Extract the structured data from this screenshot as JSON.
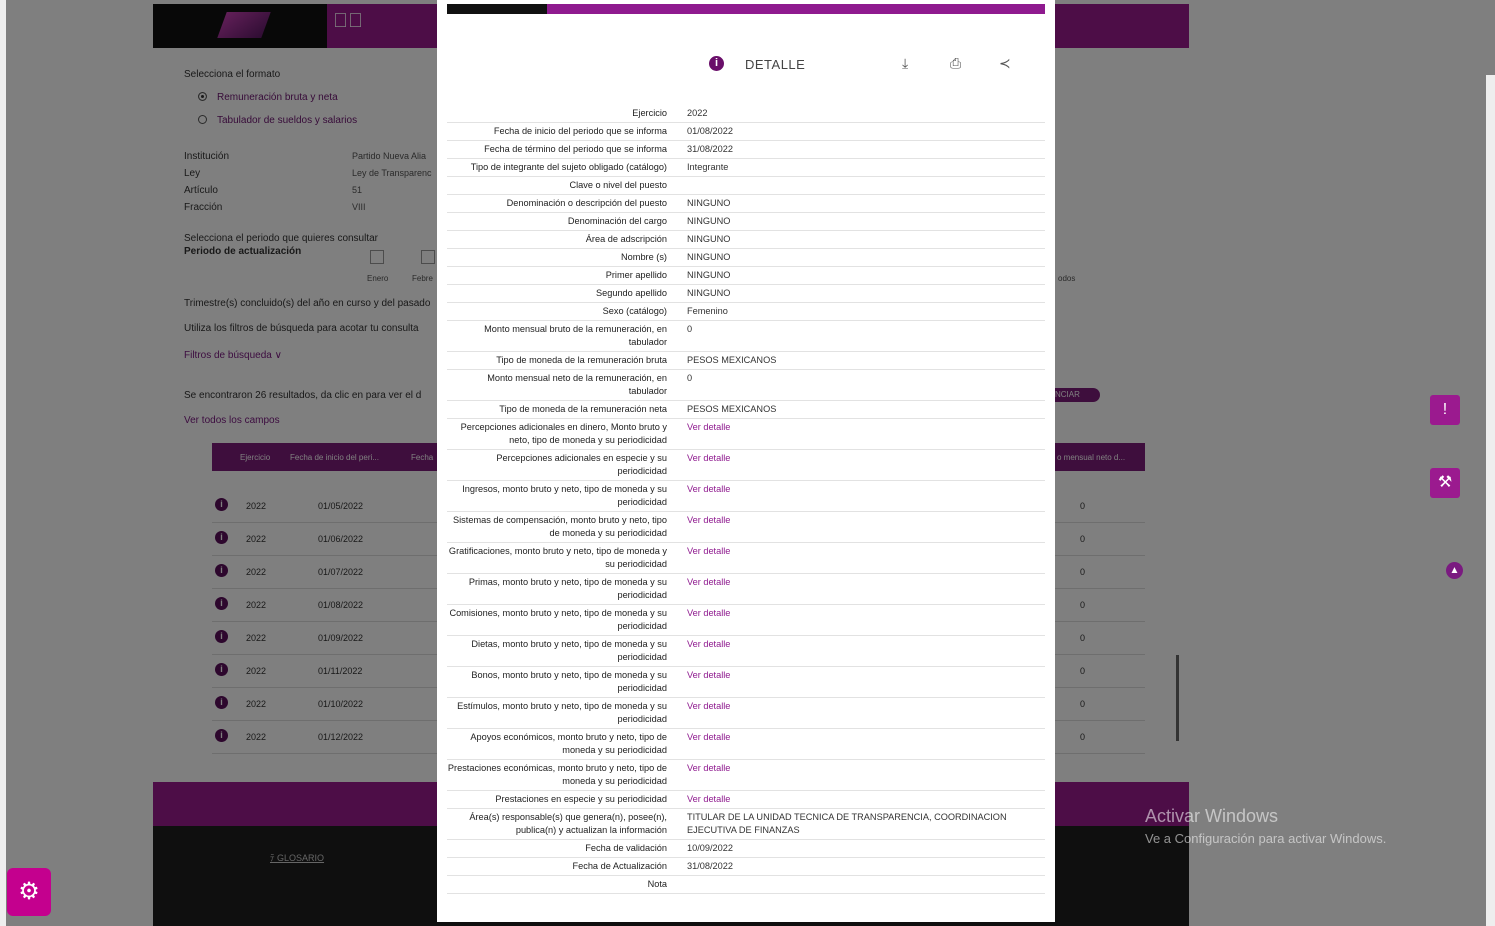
{
  "colors": {
    "brand": "#9b1a8f",
    "dark": "#1e1e1e",
    "link": "#8f1a8f"
  },
  "background": {
    "format_label": "Selecciona el formato",
    "radio_options": [
      "Remuneración bruta y neta",
      "Tabulador de sueldos y salarios"
    ],
    "info": [
      {
        "k": "Institución",
        "v": "Partido Nueva Alia"
      },
      {
        "k": "Ley",
        "v": "Ley de Transparenc"
      },
      {
        "k": "Artículo",
        "v": "51"
      },
      {
        "k": "Fracción",
        "v": "VIII"
      }
    ],
    "period_label": "Selecciona el periodo que quieres consultar",
    "period_update_label": "Periodo de actualización",
    "months": [
      "Enero",
      "Febre"
    ],
    "todos": "odos",
    "trimestre_text": "Trimestre(s) concluido(s) del año en curso y del pasado",
    "filters_hint": "Utiliza los filtros de búsqueda para acotar tu consulta",
    "filters_link": "Filtros de búsqueda ∨",
    "results_text": "Se encontraron 26 resultados, da clic en  para ver el d",
    "show_all": "Ver todos los campos",
    "denunciar": "NCIAR",
    "table_headers": [
      "Ejercicio",
      "Fecha de inicio del peri...",
      "Fecha",
      "o mensual neto d..."
    ],
    "table_rows": [
      {
        "y": "2022",
        "d": "01/05/2022",
        "z": "0"
      },
      {
        "y": "2022",
        "d": "01/06/2022",
        "z": "0"
      },
      {
        "y": "2022",
        "d": "01/07/2022",
        "z": "0"
      },
      {
        "y": "2022",
        "d": "01/08/2022",
        "z": "0"
      },
      {
        "y": "2022",
        "d": "01/09/2022",
        "z": "0"
      },
      {
        "y": "2022",
        "d": "01/11/2022",
        "z": "0"
      },
      {
        "y": "2022",
        "d": "01/10/2022",
        "z": "0"
      },
      {
        "y": "2022",
        "d": "01/12/2022",
        "z": "0"
      }
    ],
    "glosario": "GLOSARIO"
  },
  "watermark": {
    "line1": "Activar Windows",
    "line2": "Ve a Configuración para activar Windows."
  },
  "modal": {
    "title": "DETALLE",
    "fields": [
      {
        "k": "Ejercicio",
        "v": "2022"
      },
      {
        "k": "Fecha de inicio del periodo que se informa",
        "v": "01/08/2022"
      },
      {
        "k": "Fecha de término del periodo que se informa",
        "v": "31/08/2022"
      },
      {
        "k": "Tipo de integrante del sujeto obligado (catálogo)",
        "v": "Integrante"
      },
      {
        "k": "Clave o nivel del puesto",
        "v": ""
      },
      {
        "k": "Denominación o descripción del puesto",
        "v": "NINGUNO"
      },
      {
        "k": "Denominación del cargo",
        "v": "NINGUNO"
      },
      {
        "k": "Área de adscripción",
        "v": "NINGUNO"
      },
      {
        "k": "Nombre (s)",
        "v": "NINGUNO"
      },
      {
        "k": "Primer apellido",
        "v": "NINGUNO"
      },
      {
        "k": "Segundo apellido",
        "v": "NINGUNO"
      },
      {
        "k": "Sexo (catálogo)",
        "v": "Femenino"
      },
      {
        "k": "Monto mensual bruto de la remuneración, en tabulador",
        "v": "0"
      },
      {
        "k": "Tipo de moneda de la remuneración bruta",
        "v": "PESOS MEXICANOS"
      },
      {
        "k": "Monto mensual neto de la remuneración, en tabulador",
        "v": "0"
      },
      {
        "k": "Tipo de moneda de la remuneración neta",
        "v": "PESOS MEXICANOS"
      },
      {
        "k": "Percepciones adicionales en dinero, Monto bruto y neto, tipo de moneda y su periodicidad",
        "v": "Ver detalle",
        "link": true
      },
      {
        "k": "Percepciones adicionales en especie y su periodicidad",
        "v": "Ver detalle",
        "link": true
      },
      {
        "k": "Ingresos, monto bruto y neto, tipo de moneda y su periodicidad",
        "v": "Ver detalle",
        "link": true
      },
      {
        "k": "Sistemas de compensación, monto bruto y neto, tipo de moneda y su periodicidad",
        "v": "Ver detalle",
        "link": true
      },
      {
        "k": "Gratificaciones, monto bruto y neto, tipo de moneda y su periodicidad",
        "v": "Ver detalle",
        "link": true
      },
      {
        "k": "Primas, monto bruto y neto, tipo de moneda y su periodicidad",
        "v": "Ver detalle",
        "link": true
      },
      {
        "k": "Comisiones, monto bruto y neto, tipo de moneda y su periodicidad",
        "v": "Ver detalle",
        "link": true
      },
      {
        "k": "Dietas, monto bruto y neto, tipo de moneda y su periodicidad",
        "v": "Ver detalle",
        "link": true
      },
      {
        "k": "Bonos, monto bruto y neto, tipo de moneda y su periodicidad",
        "v": "Ver detalle",
        "link": true
      },
      {
        "k": "Estímulos, monto bruto y neto, tipo de moneda y su periodicidad",
        "v": "Ver detalle",
        "link": true
      },
      {
        "k": "Apoyos económicos, monto bruto y neto, tipo de moneda y su periodicidad",
        "v": "Ver detalle",
        "link": true
      },
      {
        "k": "Prestaciones económicas, monto bruto y neto, tipo de moneda y su periodicidad",
        "v": "Ver detalle",
        "link": true
      },
      {
        "k": "Prestaciones en especie y su periodicidad",
        "v": "Ver detalle",
        "link": true
      },
      {
        "k": "Área(s) responsable(s) que genera(n), posee(n), publica(n) y actualizan la información",
        "v": "TITULAR DE LA UNIDAD TECNICA DE TRANSPARENCIA, COORDINACION EJECUTIVA DE FINANZAS"
      },
      {
        "k": "Fecha de validación",
        "v": "10/09/2022"
      },
      {
        "k": "Fecha de Actualización",
        "v": "31/08/2022"
      },
      {
        "k": "Nota",
        "v": ""
      }
    ]
  }
}
